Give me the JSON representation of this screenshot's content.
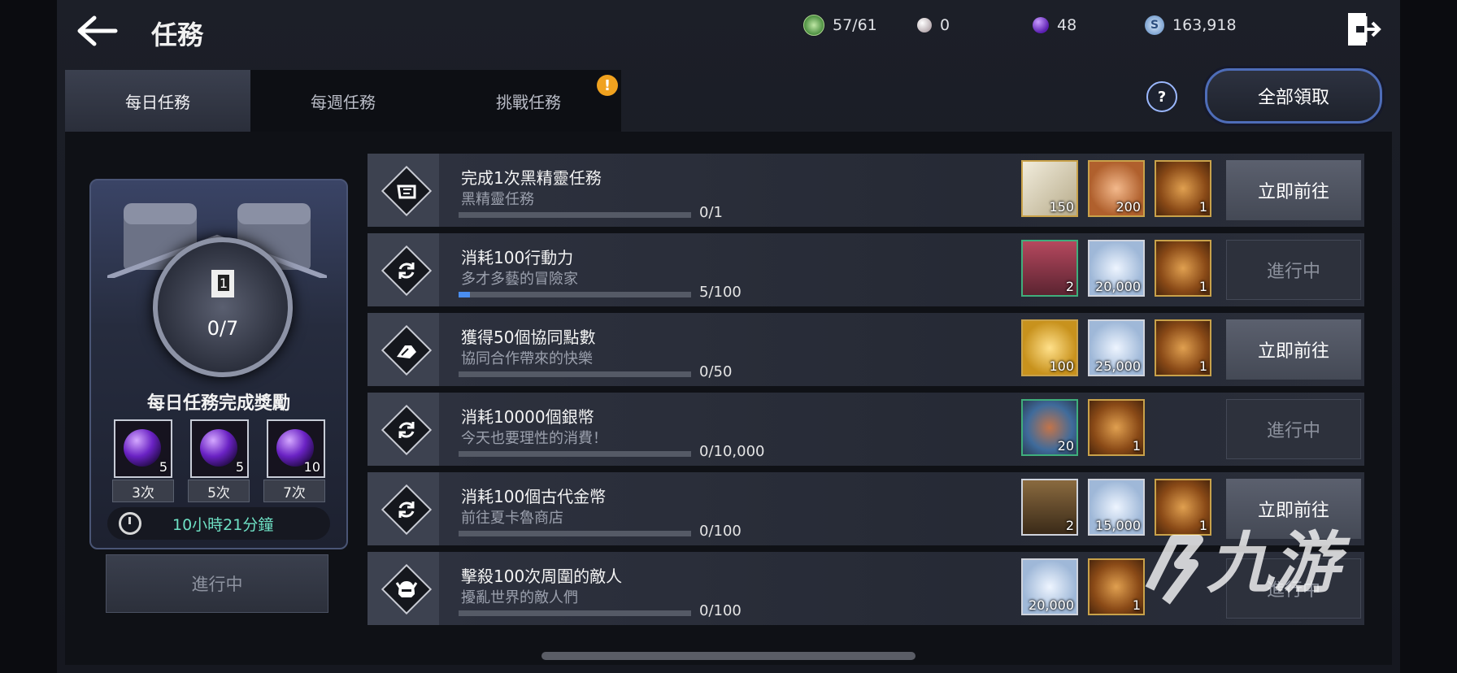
{
  "header": {
    "title": "任務",
    "resources": [
      {
        "name": "stamina-icon",
        "value": "57/61",
        "color": "#5fae5a"
      },
      {
        "name": "pearl-icon",
        "value": "0",
        "color": "#d9d0d3"
      },
      {
        "name": "purple-orb-icon",
        "value": "48",
        "color": "#7a3fe0"
      },
      {
        "name": "silver-coin-icon",
        "value": "163,918",
        "color": "#9fc0e8"
      }
    ]
  },
  "tabs": [
    {
      "label": "每日任務",
      "active": true
    },
    {
      "label": "每週任務",
      "active": false
    },
    {
      "label": "挑戰任務",
      "active": false,
      "badge": "!"
    }
  ],
  "claim_all": "全部領取",
  "help_icon": "?",
  "daily_reward": {
    "progress": "0/7",
    "title": "每日任務完成獎勵",
    "orbs": [
      {
        "count": "5",
        "times": "3次"
      },
      {
        "count": "5",
        "times": "5次"
      },
      {
        "count": "10",
        "times": "7次"
      }
    ],
    "timer": "10小時21分鐘",
    "button": "進行中"
  },
  "quests": [
    {
      "title": "完成1次黑精靈任務",
      "subtitle": "黑精靈任務",
      "progress": "0/1",
      "fraction": 0,
      "icon": "scroll-icon",
      "rewards": [
        {
          "icon": "scroll-reward-icon",
          "count": "150",
          "frame": "gold"
        },
        {
          "icon": "bronze-coin-icon",
          "count": "200",
          "frame": "gold"
        },
        {
          "icon": "medal-icon",
          "count": "1",
          "frame": "gold"
        }
      ],
      "action": "立即前往",
      "active": true
    },
    {
      "title": "消耗100行動力",
      "subtitle": "多才多藝的冒險家",
      "progress": "5/100",
      "fraction": 0.05,
      "icon": "cycle-icon",
      "rewards": [
        {
          "icon": "chest-icon",
          "count": "2",
          "frame": "green"
        },
        {
          "icon": "silver-coin-icon",
          "count": "20,000",
          "frame": "white"
        },
        {
          "icon": "medal-icon",
          "count": "1",
          "frame": "gold"
        }
      ],
      "action": "進行中",
      "active": false
    },
    {
      "title": "獲得50個協同點數",
      "subtitle": "協同合作帶來的快樂",
      "progress": "0/50",
      "fraction": 0,
      "icon": "handshake-icon",
      "rewards": [
        {
          "icon": "gold-coin-icon",
          "count": "100",
          "frame": "gold"
        },
        {
          "icon": "silver-coin-icon",
          "count": "25,000",
          "frame": "white"
        },
        {
          "icon": "medal-icon",
          "count": "1",
          "frame": "gold"
        }
      ],
      "action": "立即前往",
      "active": true
    },
    {
      "title": "消耗10000個銀幣",
      "subtitle": "今天也要理性的消費！",
      "progress": "0/10,000",
      "fraction": 0,
      "icon": "cycle-icon",
      "rewards": [
        {
          "icon": "food-bowl-icon",
          "count": "20",
          "frame": "green"
        },
        {
          "icon": "medal-icon",
          "count": "1",
          "frame": "gold"
        }
      ],
      "action": "進行中",
      "active": false
    },
    {
      "title": "消耗100個古代金幣",
      "subtitle": "前往夏卡魯商店",
      "progress": "0/100",
      "fraction": 0,
      "icon": "cycle-icon",
      "rewards": [
        {
          "icon": "treasure-chest-icon",
          "count": "2",
          "frame": "white"
        },
        {
          "icon": "silver-coin-icon",
          "count": "15,000",
          "frame": "white"
        },
        {
          "icon": "medal-icon",
          "count": "1",
          "frame": "gold"
        }
      ],
      "action": "立即前往",
      "active": true
    },
    {
      "title": "擊殺100次周圍的敵人",
      "subtitle": "擾亂世界的敵人們",
      "progress": "0/100",
      "fraction": 0,
      "icon": "helmet-icon",
      "rewards": [
        {
          "icon": "silver-coin-icon",
          "count": "20,000",
          "frame": "white"
        },
        {
          "icon": "medal-icon",
          "count": "1",
          "frame": "gold"
        }
      ],
      "action": "進行中",
      "active": false
    }
  ],
  "watermark": "九游"
}
